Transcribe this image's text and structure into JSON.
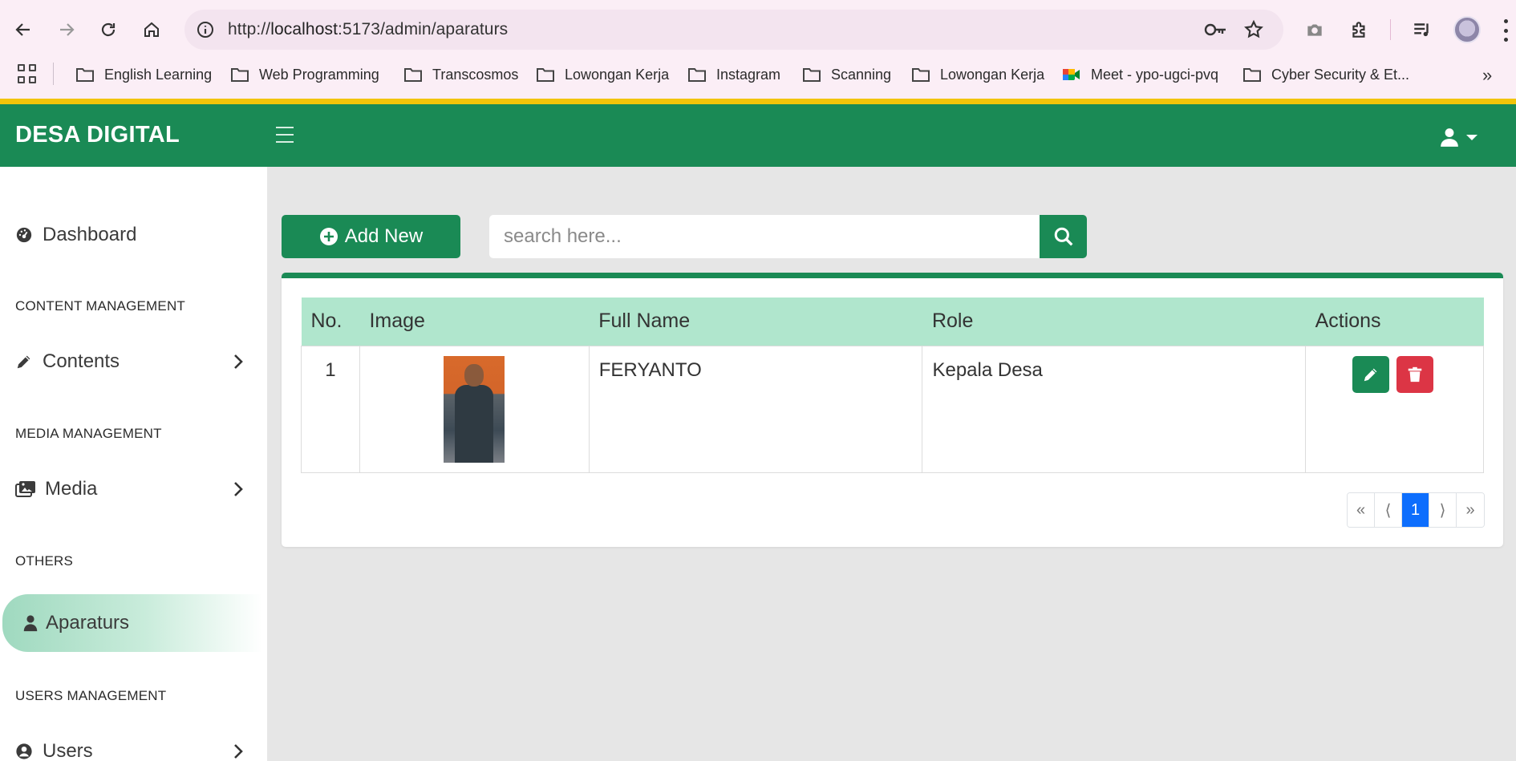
{
  "browser": {
    "url_prefix": "http://",
    "url_host": "localhost",
    "url_rest": ":5173/admin/aparaturs",
    "bookmarks": [
      {
        "label": "English Learning",
        "icon": "folder-icon"
      },
      {
        "label": "Web Programming",
        "icon": "folder-icon"
      },
      {
        "label": "Transcosmos",
        "icon": "folder-icon"
      },
      {
        "label": "Lowongan Kerja",
        "icon": "folder-icon"
      },
      {
        "label": "Instagram",
        "icon": "folder-icon"
      },
      {
        "label": "Scanning",
        "icon": "folder-icon"
      },
      {
        "label": "Lowongan Kerja",
        "icon": "folder-icon"
      },
      {
        "label": "Meet - ypo-ugci-pvq",
        "icon": "meet-icon"
      },
      {
        "label": "Cyber Security & Et...",
        "icon": "folder-icon"
      }
    ],
    "more_label": "»"
  },
  "header": {
    "brand": "DESA DIGITAL"
  },
  "sidebar": {
    "items": [
      {
        "label": "Dashboard",
        "icon": "gauge-icon"
      },
      {
        "section": "CONTENT MANAGEMENT"
      },
      {
        "label": "Contents",
        "icon": "pencil-icon"
      },
      {
        "section": "MEDIA MANAGEMENT"
      },
      {
        "label": "Media",
        "icon": "images-icon"
      },
      {
        "section": "OTHERS"
      },
      {
        "label": "Aparaturs",
        "icon": "user-icon",
        "active": true
      },
      {
        "section": "USERS MANAGEMENT"
      },
      {
        "label": "Users",
        "icon": "user-circle-icon"
      }
    ]
  },
  "toolbar": {
    "add_label": "Add New",
    "search_placeholder": "search here..."
  },
  "table": {
    "columns": [
      "No.",
      "Image",
      "Full Name",
      "Role",
      "Actions"
    ],
    "rows": [
      {
        "no": "1",
        "full_name": "FERYANTO",
        "role": "Kepala Desa"
      }
    ]
  },
  "pagination": {
    "first": "«",
    "prev": "⟨",
    "current": "1",
    "next": "⟩",
    "last": "»"
  },
  "colors": {
    "primary": "#1a8a55",
    "header_row": "#b0e6cd",
    "danger": "#dc3545",
    "page_active": "#0d6efd",
    "accent_strip": "#f2c409"
  }
}
